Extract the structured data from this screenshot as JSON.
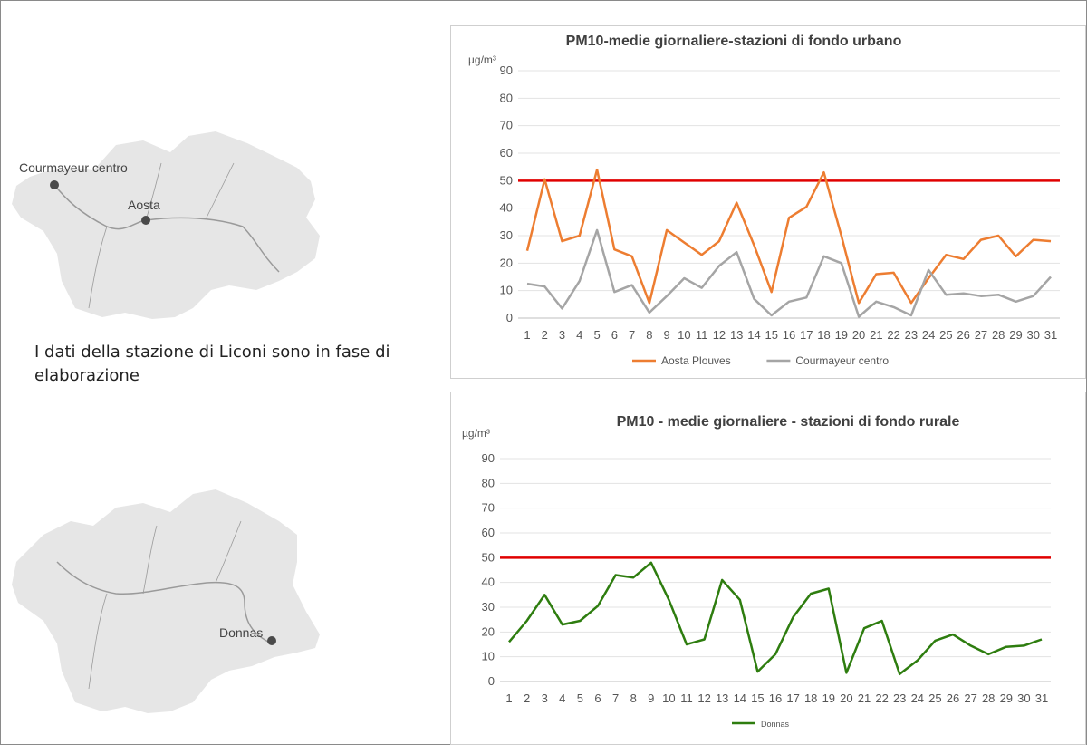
{
  "maps": {
    "top_labels": {
      "courmayeur": "Courmayeur centro",
      "aosta": "Aosta"
    },
    "bottom_labels": {
      "donnas": "Donnas"
    },
    "colors": {
      "region_fill": "#e6e6e6",
      "river": "#9a9a9a",
      "station": "#4a4a4a"
    }
  },
  "note": {
    "text": "I dati della stazione di Liconi sono in fase di elaborazione"
  },
  "chart_data": [
    {
      "type": "line",
      "title": "PM10-medie giornaliere-stazioni di fondo urbano",
      "ylabel": "µg/m³",
      "xlabel": "",
      "ylim": [
        0,
        90
      ],
      "yticks": [
        0,
        10,
        20,
        30,
        40,
        50,
        60,
        70,
        80,
        90
      ],
      "categories": [
        "1",
        "2",
        "3",
        "4",
        "5",
        "6",
        "7",
        "8",
        "9",
        "10",
        "11",
        "12",
        "13",
        "14",
        "15",
        "16",
        "17",
        "18",
        "19",
        "20",
        "21",
        "22",
        "23",
        "24",
        "25",
        "26",
        "27",
        "28",
        "29",
        "30",
        "31"
      ],
      "threshold": {
        "value": 50,
        "color": "#e00000"
      },
      "series": [
        {
          "name": "Aosta Plouves",
          "color": "#ed7d31",
          "values": [
            24.5,
            50.5,
            28,
            30,
            54,
            25,
            22.5,
            5.5,
            32,
            27.5,
            23,
            28,
            42,
            26.5,
            9.5,
            36.5,
            40.5,
            53,
            30,
            5.5,
            16,
            16.5,
            5.5,
            14.5,
            23,
            21.5,
            28.5,
            30,
            22.5,
            28.5,
            28
          ]
        },
        {
          "name": "Courmayeur centro",
          "color": "#a5a5a5",
          "values": [
            12.5,
            11.5,
            3.5,
            13.5,
            32,
            9.5,
            12,
            2,
            8,
            14.5,
            11,
            19,
            24,
            7,
            1,
            6,
            7.5,
            22.5,
            20,
            0.5,
            6,
            4,
            1,
            17.5,
            8.5,
            9,
            8,
            8.5,
            6,
            8,
            15
          ]
        }
      ],
      "legend": "bottom"
    },
    {
      "type": "line",
      "title": "PM10 - medie giornaliere - stazioni di fondo rurale",
      "ylabel": "µg/m³",
      "xlabel": "",
      "ylim": [
        0,
        90
      ],
      "yticks": [
        0,
        10,
        20,
        30,
        40,
        50,
        60,
        70,
        80,
        90
      ],
      "categories": [
        "1",
        "2",
        "3",
        "4",
        "5",
        "6",
        "7",
        "8",
        "9",
        "10",
        "11",
        "12",
        "13",
        "14",
        "15",
        "16",
        "17",
        "18",
        "19",
        "20",
        "21",
        "22",
        "23",
        "24",
        "25",
        "26",
        "27",
        "28",
        "29",
        "30",
        "31"
      ],
      "threshold": {
        "value": 50,
        "color": "#e00000"
      },
      "series": [
        {
          "name": "Donnas",
          "color": "#2e7d0f",
          "values": [
            16,
            24.5,
            35,
            23,
            24.5,
            30.5,
            43,
            42,
            48,
            33,
            15,
            17,
            41,
            33,
            4,
            11,
            26,
            35.5,
            37.5,
            3.5,
            21.5,
            24.5,
            3,
            8.5,
            16.5,
            19,
            14.5,
            11,
            14,
            14.5,
            17
          ]
        }
      ],
      "legend": "bottom"
    }
  ]
}
